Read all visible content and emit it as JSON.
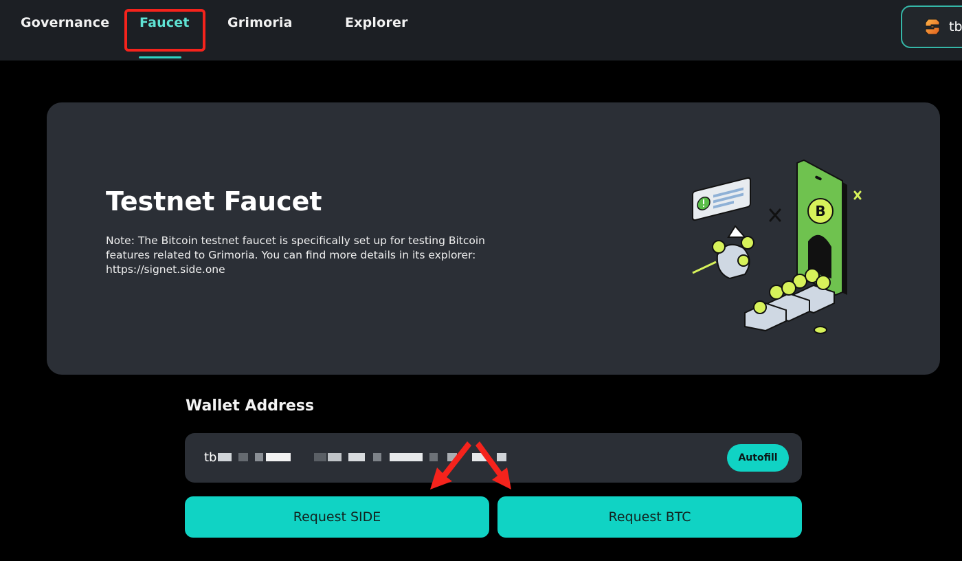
{
  "nav": {
    "items": [
      {
        "label": "Governance"
      },
      {
        "label": "Faucet",
        "active": true
      },
      {
        "label": "Grimoria"
      },
      {
        "label": "Explorer"
      }
    ],
    "wallet_short": "tb"
  },
  "hero": {
    "title": "Testnet Faucet",
    "note": "Note: The Bitcoin testnet faucet is specifically set up for testing Bitcoin features related to Grimoria. You can find more details in its explorer: https://signet.side.one",
    "illustration": "bitcoin-mining-cart-illustration"
  },
  "wallet": {
    "label": "Wallet Address",
    "address_prefix": "tb",
    "autofill_label": "Autofill"
  },
  "actions": {
    "request_side": "Request SIDE",
    "request_btc": "Request BTC"
  },
  "colors": {
    "accent": "#10d3c4",
    "nav_active": "#5fe3d4",
    "card_bg": "#2b2f36",
    "annotation_red": "#f5231c"
  }
}
